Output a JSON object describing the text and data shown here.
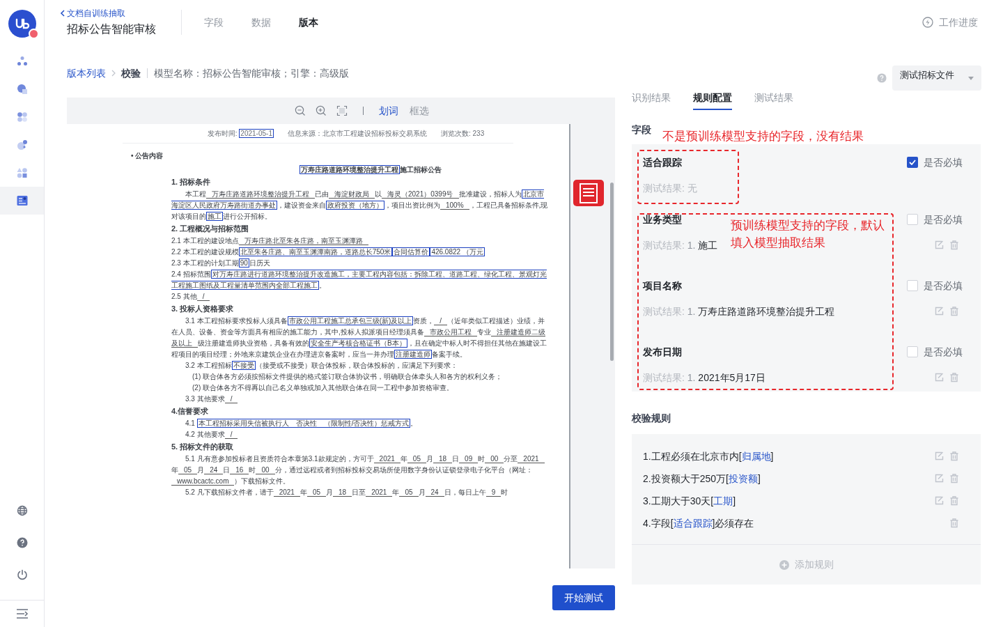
{
  "header": {
    "back_link": "文档自训练抽取",
    "title": "招标公告智能审核",
    "tabs": [
      {
        "label": "字段",
        "selected": false
      },
      {
        "label": "数据",
        "selected": false
      },
      {
        "label": "版本",
        "selected": true
      }
    ],
    "progress": "工作进度"
  },
  "sidebar": {
    "items": [
      {
        "selected": false
      },
      {
        "selected": false
      },
      {
        "selected": false
      },
      {
        "selected": false
      },
      {
        "selected": false
      },
      {
        "selected": true
      }
    ]
  },
  "breadcrumb": {
    "link": "版本列表",
    "current": "校验",
    "info": "模型名称：招标公告智能审核；引擎：高级版"
  },
  "viewer": {
    "modes": [
      {
        "label": "划词",
        "selected": true
      },
      {
        "label": "框选",
        "selected": false
      }
    ],
    "document": [
      {
        "kind": "meta",
        "segments": [
          {
            "kind": "text",
            "text": "发布时间: "
          },
          {
            "kind": "mark",
            "text": "2021-05-1"
          },
          {
            "kind": "text",
            "text": "　　信息来源：北京市工程建设招标投标交易系统　　浏览次数:  233"
          }
        ]
      },
      {
        "kind": "bullet",
        "segments": [
          {
            "kind": "text",
            "text": "• 公告内容"
          }
        ]
      },
      {
        "kind": "title",
        "segments": [
          {
            "kind": "mark",
            "text": "万寿庄路道路环境整治提升工程"
          },
          {
            "kind": "text",
            "text": "施工招标公告"
          }
        ]
      },
      {
        "kind": "heading",
        "segments": [
          {
            "kind": "text",
            "text": "1. 招标条件"
          }
        ]
      },
      {
        "kind": "para",
        "segments": [
          {
            "kind": "text",
            "text": "本工程"
          },
          {
            "kind": "blank",
            "text": "万寿庄路道路环境整治提升工程"
          },
          {
            "kind": "text",
            "text": "已由"
          },
          {
            "kind": "blank",
            "text": "海淀财政局"
          },
          {
            "kind": "text",
            "text": "以"
          },
          {
            "kind": "blank",
            "text": "海灵（2021）0399号"
          },
          {
            "kind": "text",
            "text": "批准建设，招标人为"
          },
          {
            "kind": "mark",
            "text": "北京市海淀区人民政府万寿路街道办事处"
          },
          {
            "kind": "text",
            "text": "，建设资金来自"
          },
          {
            "kind": "mark",
            "text": "政府投资（地方）"
          },
          {
            "kind": "text",
            "text": "，项目出资比例为"
          },
          {
            "kind": "blank",
            "text": "100%"
          },
          {
            "kind": "text",
            "text": "，工程已具备招标条件,现对该项目的"
          },
          {
            "kind": "mark",
            "text": "施工"
          },
          {
            "kind": "text",
            "text": "进行公开招标。"
          }
        ]
      },
      {
        "kind": "heading",
        "segments": [
          {
            "kind": "text",
            "text": "2. 工程概况与招标范围"
          }
        ]
      },
      {
        "kind": "line",
        "segments": [
          {
            "kind": "text",
            "text": "2.1  本工程的建设地点"
          },
          {
            "kind": "blank",
            "text": "万寿庄路北至朱各庄路，南至玉渊潭路"
          }
        ]
      },
      {
        "kind": "line",
        "segments": [
          {
            "kind": "text",
            "text": "2.2  本工程的建设规模"
          },
          {
            "kind": "mark",
            "text": "北至朱各庄路、南至玉渊潭南路，道路总长750米"
          },
          {
            "kind": "mark",
            "text": "合同估算价"
          },
          {
            "kind": "mark",
            "text": "426.0822 （万元"
          }
        ]
      },
      {
        "kind": "line",
        "segments": [
          {
            "kind": "text",
            "text": "2.3  本工程的计划工期"
          },
          {
            "kind": "mark",
            "text": "90"
          },
          {
            "kind": "text",
            "text": "日历天"
          }
        ]
      },
      {
        "kind": "line",
        "segments": [
          {
            "kind": "text",
            "text": "2.4  招标范围"
          },
          {
            "kind": "mark",
            "text": "对万寿庄路进行道路环境整治提升改造施工，主要工程内容包括：拆除工程、道路工程、绿化工程、景观灯光工程施工图纸及工程量清单范围内全部工程施工"
          },
          {
            "kind": "text",
            "text": "。"
          }
        ]
      },
      {
        "kind": "line",
        "segments": [
          {
            "kind": "text",
            "text": "2.5  其他"
          },
          {
            "kind": "blank",
            "text": "/"
          }
        ]
      },
      {
        "kind": "heading",
        "segments": [
          {
            "kind": "text",
            "text": "3. 投标人资格要求"
          }
        ]
      },
      {
        "kind": "para",
        "segments": [
          {
            "kind": "text",
            "text": "3.1 本工程招标要求投标人须具备"
          },
          {
            "kind": "mark",
            "text": "市政公用工程施工总承包三级(新)及以上"
          },
          {
            "kind": "text",
            "text": "资质，"
          },
          {
            "kind": "blank",
            "text": "/"
          },
          {
            "kind": "text",
            "text": "（近年类似工程描述）业绩，并在人员、设备、资金等方面具有相应的施工能力，其中,投标人拟派项目经理须具备"
          },
          {
            "kind": "blank",
            "text": "市政公用工程"
          },
          {
            "kind": "text",
            "text": "专业"
          },
          {
            "kind": "blank",
            "text": "注册建造师二级及以上"
          },
          {
            "kind": "text",
            "text": "级注册建造师执业资格，具备有效的"
          },
          {
            "kind": "mark",
            "text": "安全生产考核合格证书（B本）"
          },
          {
            "kind": "text",
            "text": "，且在确定中标人时不得担任其他在施建设工程项目的项目经理；外地来京建筑企业在办理进京备案时，应当一并办理"
          },
          {
            "kind": "mark",
            "text": "注册建造师"
          },
          {
            "kind": "text",
            "text": "备案手续。"
          }
        ]
      },
      {
        "kind": "para",
        "segments": [
          {
            "kind": "text",
            "text": "3.2 本工程招标"
          },
          {
            "kind": "mark",
            "text": "不接受"
          },
          {
            "kind": "text",
            "text": "（接受或不接受）联合体投标，联合体投标的，应满足下列要求："
          }
        ]
      },
      {
        "kind": "sub",
        "segments": [
          {
            "kind": "text",
            "text": "(1) 联合体各方必须按招标文件提供的格式签订联合体协议书，明确联合体牵头人和各方的权利义务；"
          }
        ]
      },
      {
        "kind": "sub",
        "segments": [
          {
            "kind": "text",
            "text": "(2) 联合体各方不得再以自己名义单独或加入其他联合体在同一工程中参加资格审查。"
          }
        ]
      },
      {
        "kind": "para",
        "segments": [
          {
            "kind": "text",
            "text": "3.3 其他要求"
          },
          {
            "kind": "blank",
            "text": "/"
          }
        ]
      },
      {
        "kind": "heading",
        "segments": [
          {
            "kind": "text",
            "text": "4.信誉要求"
          }
        ]
      },
      {
        "kind": "para",
        "segments": [
          {
            "kind": "text",
            "text": "4.1 "
          },
          {
            "kind": "mark",
            "text": "本工程招标采用失信被执行人　否决性　（限制性/否决性）惩戒方式"
          },
          {
            "kind": "text",
            "text": "。"
          }
        ]
      },
      {
        "kind": "para",
        "segments": [
          {
            "kind": "text",
            "text": "4.2 其他要求"
          },
          {
            "kind": "blank",
            "text": "/"
          }
        ]
      },
      {
        "kind": "heading",
        "segments": [
          {
            "kind": "text",
            "text": "5. 招标文件的获取"
          }
        ]
      },
      {
        "kind": "para",
        "segments": [
          {
            "kind": "text",
            "text": "5.1 凡有意参加投标者且资质符合本章第3.1款规定的，方可于"
          },
          {
            "kind": "blank",
            "text": "2021"
          },
          {
            "kind": "text",
            "text": "年"
          },
          {
            "kind": "blank",
            "text": "05"
          },
          {
            "kind": "text",
            "text": "月"
          },
          {
            "kind": "blank",
            "text": "18"
          },
          {
            "kind": "text",
            "text": "日"
          },
          {
            "kind": "blank",
            "text": "09"
          },
          {
            "kind": "text",
            "text": "时"
          },
          {
            "kind": "blank",
            "text": "00"
          },
          {
            "kind": "text",
            "text": "分至"
          },
          {
            "kind": "blank",
            "text": "2021"
          },
          {
            "kind": "text",
            "text": "年"
          },
          {
            "kind": "blank",
            "text": "05"
          },
          {
            "kind": "text",
            "text": "月"
          },
          {
            "kind": "blank",
            "text": "24"
          },
          {
            "kind": "text",
            "text": "日"
          },
          {
            "kind": "blank",
            "text": "16"
          },
          {
            "kind": "text",
            "text": "时"
          },
          {
            "kind": "blank",
            "text": "00"
          },
          {
            "kind": "text",
            "text": "分，通过远程或者到招标投标交易场所使用数字身份认证锁登录电子化平台（网址："
          },
          {
            "kind": "blank",
            "text": "www.bcactc.com"
          },
          {
            "kind": "text",
            "text": "）下载招标文件。"
          }
        ]
      },
      {
        "kind": "para",
        "segments": [
          {
            "kind": "text",
            "text": "5.2 凡下载招标文件者，请于"
          },
          {
            "kind": "blank",
            "text": "2021"
          },
          {
            "kind": "text",
            "text": "年"
          },
          {
            "kind": "blank",
            "text": "05"
          },
          {
            "kind": "text",
            "text": "月"
          },
          {
            "kind": "blank",
            "text": "18"
          },
          {
            "kind": "text",
            "text": "日至"
          },
          {
            "kind": "blank",
            "text": "2021"
          },
          {
            "kind": "text",
            "text": "年"
          },
          {
            "kind": "blank",
            "text": "05"
          },
          {
            "kind": "text",
            "text": "月"
          },
          {
            "kind": "blank",
            "text": "24"
          },
          {
            "kind": "text",
            "text": "日，每日上午"
          },
          {
            "kind": "blank",
            "text": "9"
          },
          {
            "kind": "text",
            "text": "时"
          }
        ]
      }
    ]
  },
  "start_button": "开始测试",
  "panel": {
    "file_select": {
      "value": "测试招标文件"
    },
    "tabs": [
      {
        "label": "识别结果",
        "selected": false
      },
      {
        "label": "规则配置",
        "selected": true
      },
      {
        "label": "测试结果",
        "selected": false
      }
    ],
    "fields_title": "字段",
    "fields": [
      {
        "name": "适合跟踪",
        "result_label": "测试结果:",
        "has_result": false,
        "result_value": "无",
        "required_label": "是否必填",
        "required": true,
        "editable": false
      },
      {
        "name": "业务类型",
        "result_label": "测试结果:",
        "has_result": true,
        "result_index": "1.",
        "result_value": "施工",
        "required_label": "是否必填",
        "required": false,
        "editable": true
      },
      {
        "name": "项目名称",
        "result_label": "测试结果:",
        "has_result": true,
        "result_index": "1.",
        "result_value": "万寿庄路道路环境整治提升工程",
        "required_label": "是否必填",
        "required": false,
        "editable": true
      },
      {
        "name": "发布日期",
        "result_label": "测试结果:",
        "has_result": true,
        "result_index": "1.",
        "result_value": "2021年5月17日",
        "required_label": "是否必填",
        "required": false,
        "editable": true
      }
    ],
    "annotations": [
      "不是预训练模型支持的字段，没有结果",
      "预训练模型支持的字段，默认填入模型抽取结果"
    ],
    "rules_title": "校验规则",
    "rules": [
      {
        "editable": true,
        "segments": [
          {
            "kind": "text",
            "text": "1.工程必须在北京市内["
          },
          {
            "kind": "link",
            "text": "归属地"
          },
          {
            "kind": "text",
            "text": "]"
          }
        ]
      },
      {
        "editable": true,
        "segments": [
          {
            "kind": "text",
            "text": "2.投资额大于250万["
          },
          {
            "kind": "link",
            "text": "投资额"
          },
          {
            "kind": "text",
            "text": "]"
          }
        ]
      },
      {
        "editable": true,
        "segments": [
          {
            "kind": "text",
            "text": "3.工期大于30天["
          },
          {
            "kind": "link",
            "text": "工期"
          },
          {
            "kind": "text",
            "text": "]"
          }
        ]
      },
      {
        "editable": false,
        "segments": [
          {
            "kind": "text",
            "text": "4.字段["
          },
          {
            "kind": "link",
            "text": "适合跟踪"
          },
          {
            "kind": "text",
            "text": "]必须存在"
          }
        ]
      }
    ],
    "add_rule": "添加规则"
  }
}
